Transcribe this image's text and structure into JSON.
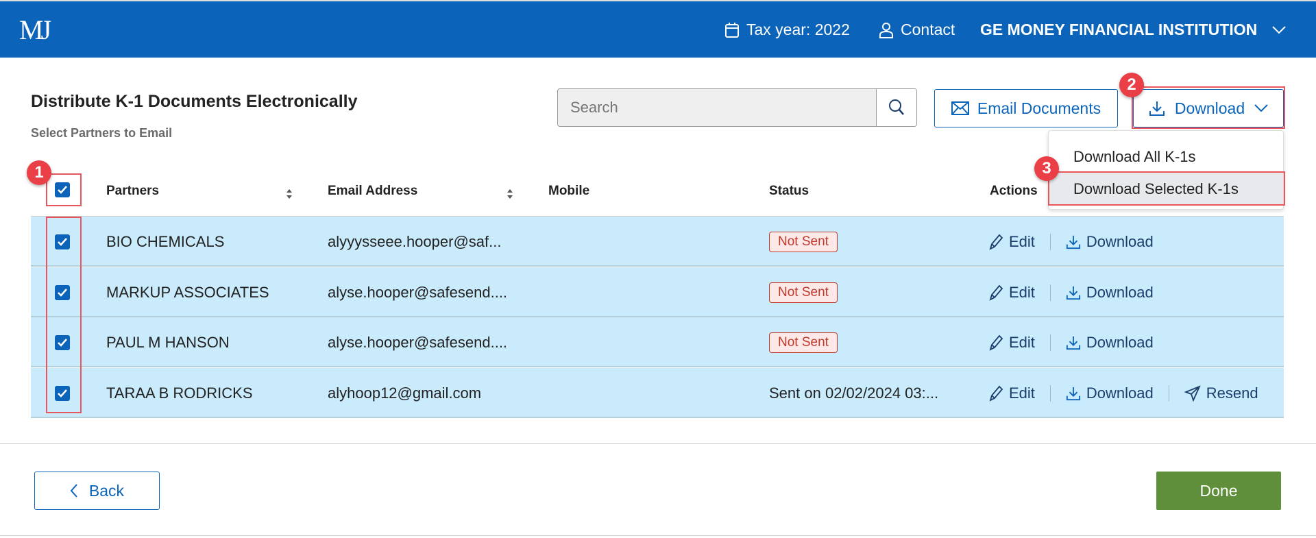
{
  "header": {
    "logo": "MJ",
    "tax_year": "Tax year: 2022",
    "contact": "Contact",
    "institution": "GE MONEY FINANCIAL INSTITUTION"
  },
  "page": {
    "title": "Distribute K-1 Documents Electronically",
    "subtitle": "Select Partners to Email"
  },
  "toolbar": {
    "search_placeholder": "Search",
    "search_value": "",
    "email_label": "Email Documents",
    "download_label": "Download"
  },
  "download_menu": {
    "items": [
      {
        "label": "Download All K-1s"
      },
      {
        "label": "Download Selected K-1s",
        "highlighted": true
      }
    ]
  },
  "table": {
    "columns": [
      "Partners",
      "Email Address",
      "Mobile",
      "Status",
      "Actions"
    ],
    "select_all": true,
    "rows": [
      {
        "partner": "BIO CHEMICALS",
        "email": "alyyysseee.hooper@saf...",
        "mobile": "",
        "status": "Not Sent",
        "checked": true,
        "edit": "Edit",
        "download": "Download"
      },
      {
        "partner": "MARKUP ASSOCIATES",
        "email": "alyse.hooper@safesend....",
        "mobile": "",
        "status": "Not Sent",
        "checked": true,
        "edit": "Edit",
        "download": "Download"
      },
      {
        "partner": "PAUL M HANSON",
        "email": "alyse.hooper@safesend....",
        "mobile": "",
        "status": "Not Sent",
        "checked": true,
        "edit": "Edit",
        "download": "Download"
      },
      {
        "partner": "TARAA B RODRICKS",
        "email": "alyhoop12@gmail.com",
        "mobile": "",
        "status": "Sent on 02/02/2024 03:...",
        "checked": true,
        "edit": "Edit",
        "download": "Download",
        "resend": "Resend"
      }
    ]
  },
  "annotations": [
    "1",
    "2",
    "3"
  ],
  "footer": {
    "back": "Back",
    "done": "Done"
  },
  "colors": {
    "brand": "#0b64b9",
    "row_selected": "#c9ebfc",
    "done": "#5f8f3a",
    "annotation": "#ea3f46",
    "not_sent": "#c0392b"
  }
}
